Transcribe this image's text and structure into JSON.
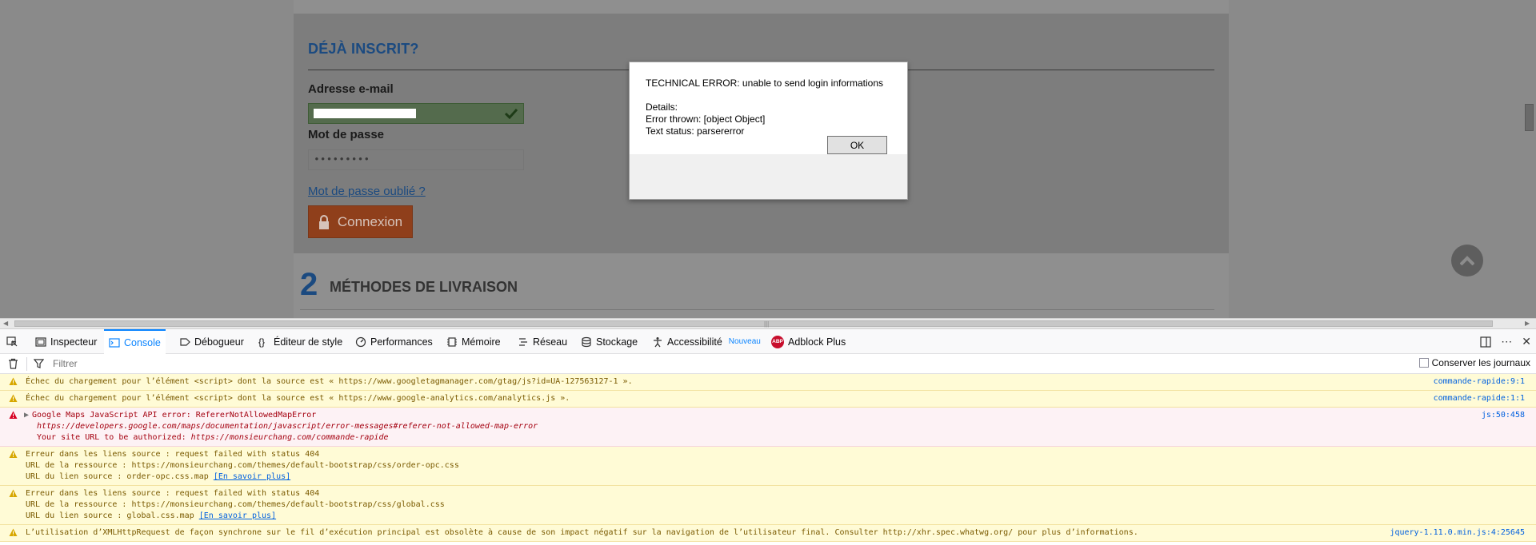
{
  "page": {
    "section_title": "DÉJÀ INSCRIT?",
    "email_label": "Adresse e-mail",
    "password_label": "Mot de passe",
    "password_value": "•••••••••",
    "forgot_link": "Mot de passe oublié ?",
    "login_button": "Connexion",
    "step_number": "2",
    "step_title": "MÉTHODES DE LIVRAISON"
  },
  "modal": {
    "line1": "TECHNICAL ERROR: unable to send login informations",
    "line2": "Details:",
    "line3": "Error thrown: [object Object]",
    "line4": "Text status: parsererror",
    "ok_label": "OK"
  },
  "devtools": {
    "tabs": [
      {
        "label": "Inspecteur",
        "icon": "inspector-icon"
      },
      {
        "label": "Console",
        "icon": "console-icon"
      },
      {
        "label": "Débogueur",
        "icon": "debugger-icon"
      },
      {
        "label": "Éditeur de style",
        "icon": "style-editor-icon"
      },
      {
        "label": "Performances",
        "icon": "performance-icon"
      },
      {
        "label": "Mémoire",
        "icon": "memory-icon"
      },
      {
        "label": "Réseau",
        "icon": "network-icon"
      },
      {
        "label": "Stockage",
        "icon": "storage-icon"
      },
      {
        "label": "Accessibilité",
        "icon": "accessibility-icon",
        "badge": "Nouveau"
      },
      {
        "label": "Adblock Plus",
        "icon": "abp-icon",
        "icon_text": "ABP"
      }
    ],
    "active_tab": "Console",
    "filter_placeholder": "Filtrer",
    "persist_logs_label": "Conserver les journaux",
    "messages": [
      {
        "type": "warn",
        "lines": [
          "Échec du chargement pour l’élément <script> dont la source est « https://www.googletagmanager.com/gtag/js?id=UA-127563127-1 »."
        ],
        "location": "commande-rapide:9:1"
      },
      {
        "type": "warn",
        "lines": [
          "Échec du chargement pour l’élément <script> dont la source est « https://www.google-analytics.com/analytics.js »."
        ],
        "location": "commande-rapide:1:1"
      },
      {
        "type": "error",
        "line1": "Google Maps JavaScript API error: RefererNotAllowedMapError",
        "line2": "https://developers.google.com/maps/documentation/javascript/error-messages#referer-not-allowed-map-error",
        "line3_prefix": "Your site URL to be authorized: ",
        "line3_url": "https://monsieurchang.com/commande-rapide",
        "location": "js:50:458"
      },
      {
        "type": "warn",
        "line1": "Erreur dans les liens source : request failed with status 404",
        "line2": "URL de la ressource : https://monsieurchang.com/themes/default-bootstrap/css/order-opc.css",
        "line3_prefix": "URL du lien source : order-opc.css.map ",
        "learn_more": "[En savoir plus]"
      },
      {
        "type": "warn",
        "line1": "Erreur dans les liens source : request failed with status 404",
        "line2": "URL de la ressource : https://monsieurchang.com/themes/default-bootstrap/css/global.css",
        "line3_prefix": "URL du lien source : global.css.map ",
        "learn_more": "[En savoir plus]"
      },
      {
        "type": "warn",
        "lines": [
          "L’utilisation d’XMLHttpRequest de façon synchrone sur le fil d’exécution principal est obsolète à cause de son impact négatif sur la navigation de l’utilisateur final. Consulter http://xhr.spec.whatwg.org/ pour plus d’informations."
        ],
        "location": "jquery-1.11.0.min.js:4:25645"
      }
    ]
  },
  "colors": {
    "accent_blue": "#1b4a80",
    "login_orange": "#8f3f1b",
    "devtools_active": "#0a84ff",
    "warn_bg": "#fffbd6",
    "error_bg": "#fdf2f5"
  }
}
